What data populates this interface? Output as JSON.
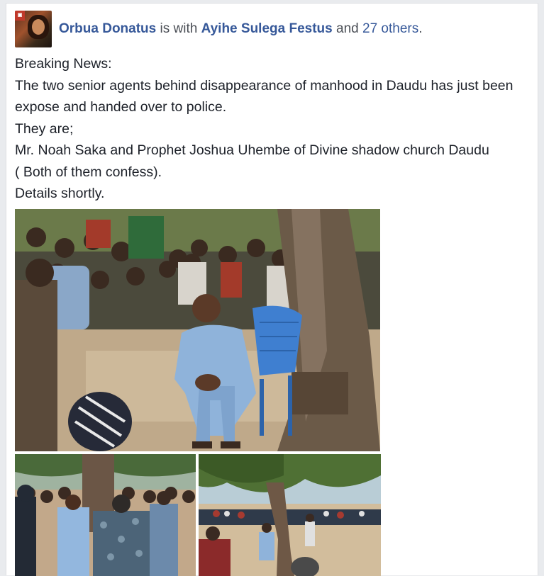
{
  "post": {
    "author": "Orbua Donatus",
    "with_text": "is with",
    "tagged": "Ayihe Sulega Festus",
    "and_text": "and",
    "others": "27 others",
    "period": ".",
    "lines": [
      "Breaking News:",
      "The two senior agents behind disappearance of manhood in Daudu has just been",
      "expose and handed over to police.",
      "They are;",
      "Mr. Noah Saka and Prophet Joshua Uhembe of Divine shadow church Daudu",
      "( Both of them confess).",
      "Details shortly."
    ]
  },
  "icons": {
    "avatar": "profile-picture"
  },
  "colors": {
    "link": "#365899",
    "text": "#1d2129",
    "muted": "#4b4f56",
    "background": "#e9ebee",
    "card": "#ffffff"
  }
}
